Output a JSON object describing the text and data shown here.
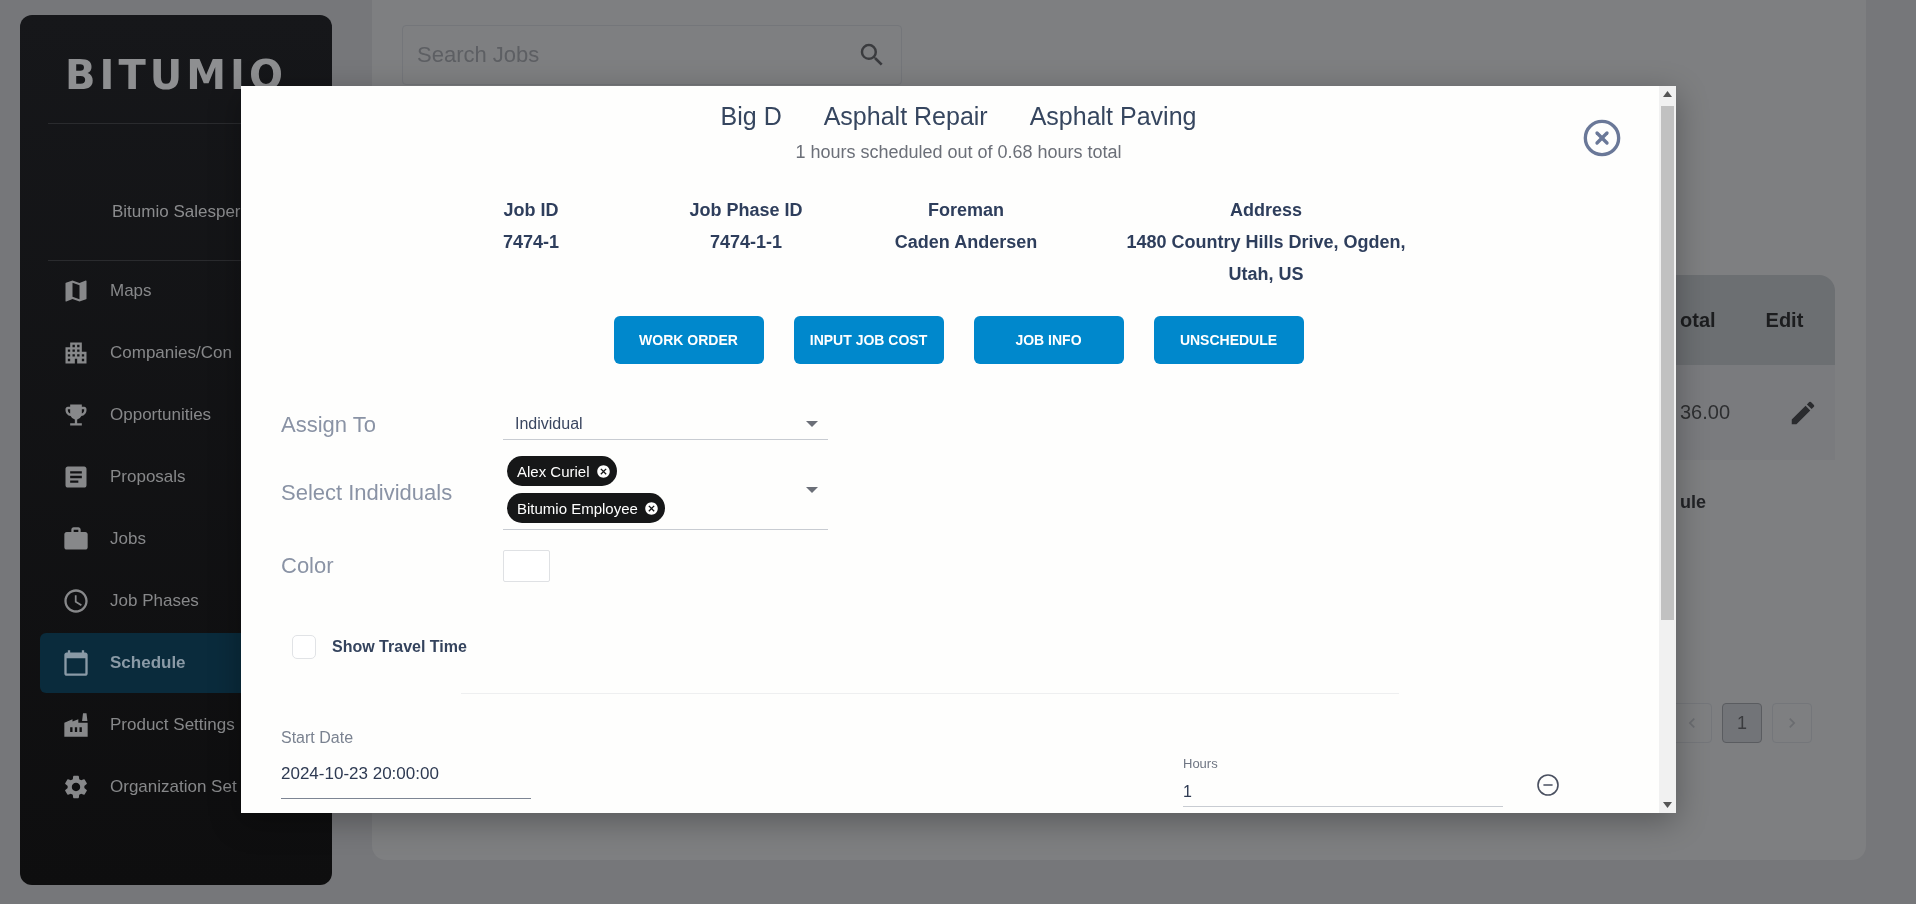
{
  "sidebar": {
    "logo": "BITUMIO",
    "user": "Bitumio Salesper",
    "items": [
      {
        "label": "Maps",
        "selected": false
      },
      {
        "label": "Companies/Con",
        "selected": false
      },
      {
        "label": "Opportunities",
        "selected": false
      },
      {
        "label": "Proposals",
        "selected": false
      },
      {
        "label": "Jobs",
        "selected": false
      },
      {
        "label": "Job Phases",
        "selected": false
      },
      {
        "label": "Schedule",
        "selected": true
      },
      {
        "label": "Product Settings",
        "selected": false
      },
      {
        "label": "Organization Set",
        "selected": false
      }
    ]
  },
  "search": {
    "placeholder": "Search Jobs"
  },
  "table": {
    "columns": [
      "otal",
      "Edit"
    ],
    "rows": [
      {
        "cells": [
          "36.00"
        ]
      }
    ]
  },
  "table_footer_link": "ule",
  "pagination": {
    "pages": [
      {
        "label": "1",
        "selected": true
      }
    ]
  },
  "modal": {
    "titles": [
      "Big D",
      "Asphalt Repair",
      "Asphalt Paving"
    ],
    "subtitle": "1 hours scheduled out of 0.68 hours total",
    "info": [
      {
        "label": "Job ID",
        "value": "7474-1"
      },
      {
        "label": "Job Phase ID",
        "value": "7474-1-1"
      },
      {
        "label": "Foreman",
        "value": "Caden Andersen"
      },
      {
        "label": "Address",
        "value": "1480 Country Hills Drive, Ogden, Utah, US"
      }
    ],
    "buttons": [
      "WORK ORDER",
      "INPUT JOB COST",
      "JOB INFO",
      "UNSCHEDULE"
    ],
    "assign_to": {
      "label": "Assign To",
      "value": "Individual"
    },
    "select_individuals": {
      "label": "Select Individuals",
      "chips": [
        "Alex Curiel",
        "Bitumio Employee"
      ]
    },
    "color": {
      "label": "Color",
      "color": "#ffffff"
    },
    "show_travel_time": {
      "label": "Show Travel Time",
      "checked": false
    },
    "start_date": {
      "label": "Start Date",
      "value": "2024-10-23 20:00:00"
    },
    "hours": {
      "label": "Hours",
      "value": "1"
    }
  }
}
